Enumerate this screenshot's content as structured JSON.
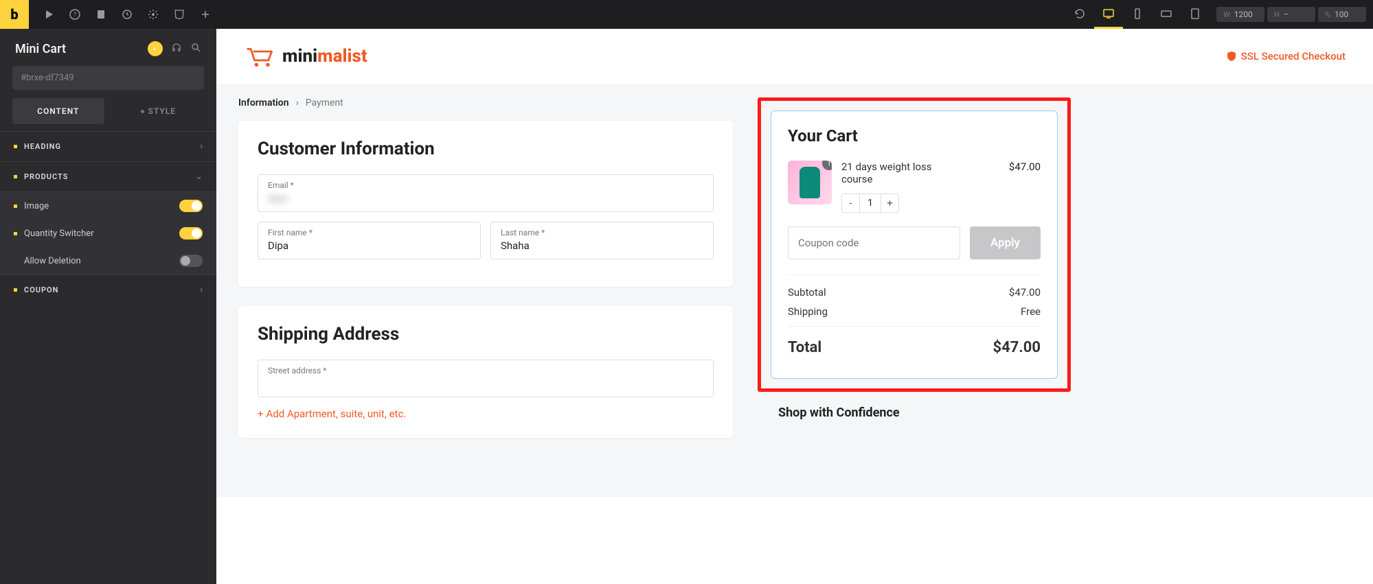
{
  "topbar": {
    "width_label": "W",
    "width_value": "1200",
    "height_label": "H",
    "height_value": "–",
    "percent_label": "%",
    "percent_value": "100"
  },
  "sidebar": {
    "title": "Mini Cart",
    "element_id": "#brxe-df7349",
    "tabs": {
      "content": "CONTENT",
      "style": "STYLE"
    },
    "sections": {
      "heading": "HEADING",
      "products": "PRODUCTS",
      "coupon": "COUPON"
    },
    "options": {
      "image": "Image",
      "qty": "Quantity Switcher",
      "deletion": "Allow Deletion"
    }
  },
  "preview": {
    "brand_a": "mini",
    "brand_b": "malist",
    "ssl": "SSL Secured Checkout",
    "breadcrumb": {
      "info": "Information",
      "payment": "Payment"
    },
    "customer": {
      "title": "Customer Information",
      "email_label": "Email *",
      "email_value": "dipa",
      "fname_label": "First name *",
      "fname_value": "Dipa",
      "lname_label": "Last name *",
      "lname_value": "Shaha"
    },
    "shipping": {
      "title": "Shipping Address",
      "street_label": "Street address *",
      "street_value": " ",
      "add_apt": "Add Apartment, suite, unit, etc."
    },
    "cart": {
      "title": "Your Cart",
      "item_name": "21 days weight loss course",
      "item_badge": "1",
      "item_qty": "1",
      "item_price": "$47.00",
      "coupon_placeholder": "Coupon code",
      "apply": "Apply",
      "subtotal_label": "Subtotal",
      "subtotal_value": "$47.00",
      "shipping_label": "Shipping",
      "shipping_value": "Free",
      "total_label": "Total",
      "total_value": "$47.00"
    },
    "confidence": "Shop with Confidence"
  }
}
